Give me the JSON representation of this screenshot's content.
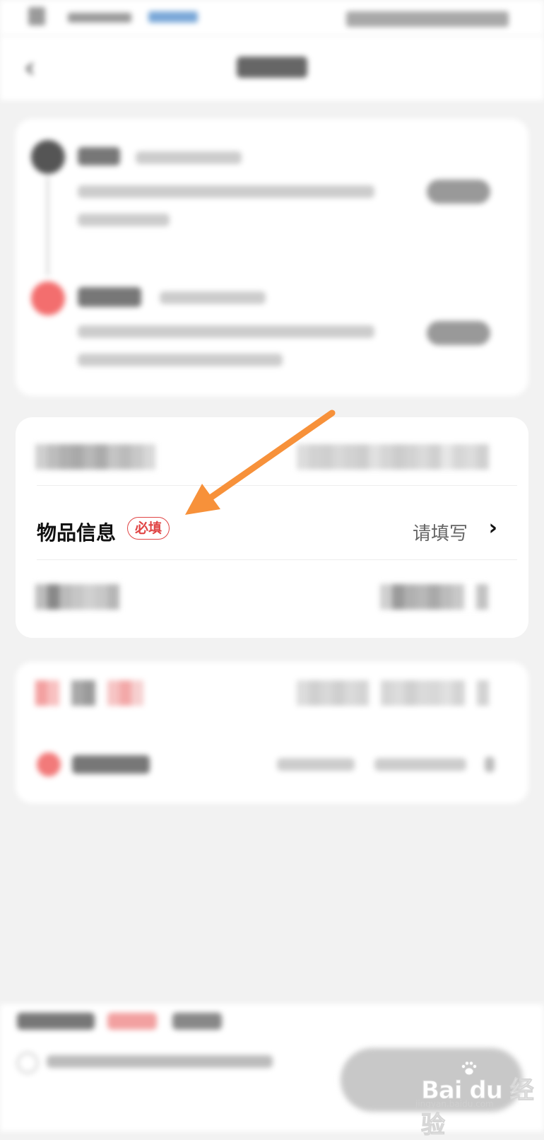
{
  "goods_row": {
    "label": "物品信息",
    "required_badge": "必填",
    "value_placeholder": "请填写"
  },
  "watermark": {
    "brand": "Bai du 经验",
    "url": "jingyan.baidu.com"
  },
  "colors": {
    "accent_red": "#e04444",
    "annotation_arrow": "#f7913a",
    "receiver_dot": "#f36e6e"
  },
  "icons": {
    "back": "back-arrow-icon",
    "chevron": "chevron-right-icon"
  }
}
